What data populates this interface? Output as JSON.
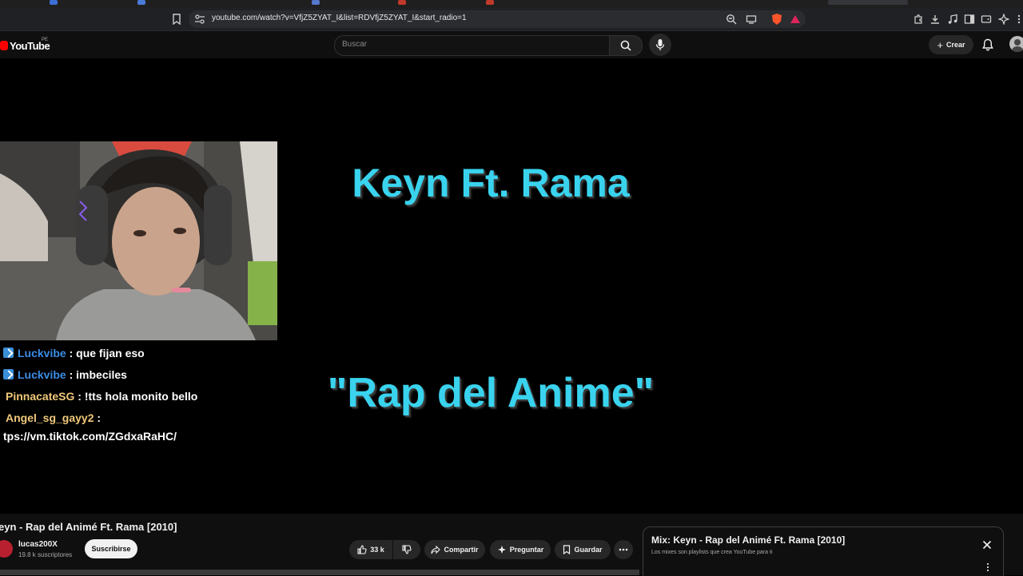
{
  "browser": {
    "url": "youtube.com/watch?v=VfjZ5ZYAT_I&list=RDVfjZ5ZYAT_I&start_radio=1"
  },
  "header": {
    "logo_text": "YouTube",
    "country_code": "PE",
    "search_placeholder": "Buscar",
    "create_label": "Crear"
  },
  "video": {
    "title_line1": "Keyn Ft. Rama",
    "title_line2": "\"Rap del Anime\""
  },
  "chat": [
    {
      "user": "Luckvibe",
      "message": ": que fijan eso"
    },
    {
      "user": "Luckvibe",
      "message": ": imbeciles"
    },
    {
      "user": "PinnacateSG",
      "message": ": !tts hola monito bello"
    },
    {
      "user": "Angel_sg_gayy2",
      "message": ":"
    },
    {
      "continuation": "tps://vm.tiktok.com/ZGdxaRaHC/"
    }
  ],
  "watch": {
    "title": "eyn - Rap del Animé Ft. Rama [2010]",
    "channel_name": "lucas200X",
    "subscribers": "19.8 k suscriptores",
    "subscribe_label": "Suscribirse",
    "likes": "33 k",
    "share_label": "Compartir",
    "ask_label": "Preguntar",
    "save_label": "Guardar"
  },
  "mix": {
    "title": "Mix: Keyn - Rap del Animé Ft. Rama [2010]",
    "subtitle": "Los mixes son playlists que crea YouTube para ti"
  },
  "colors": {
    "youtube_red": "#ff0000",
    "title_cyan": "#39d3ee",
    "chat_user_blue": "#3b8ce4",
    "chat_user_gold": "#f0c87a"
  }
}
